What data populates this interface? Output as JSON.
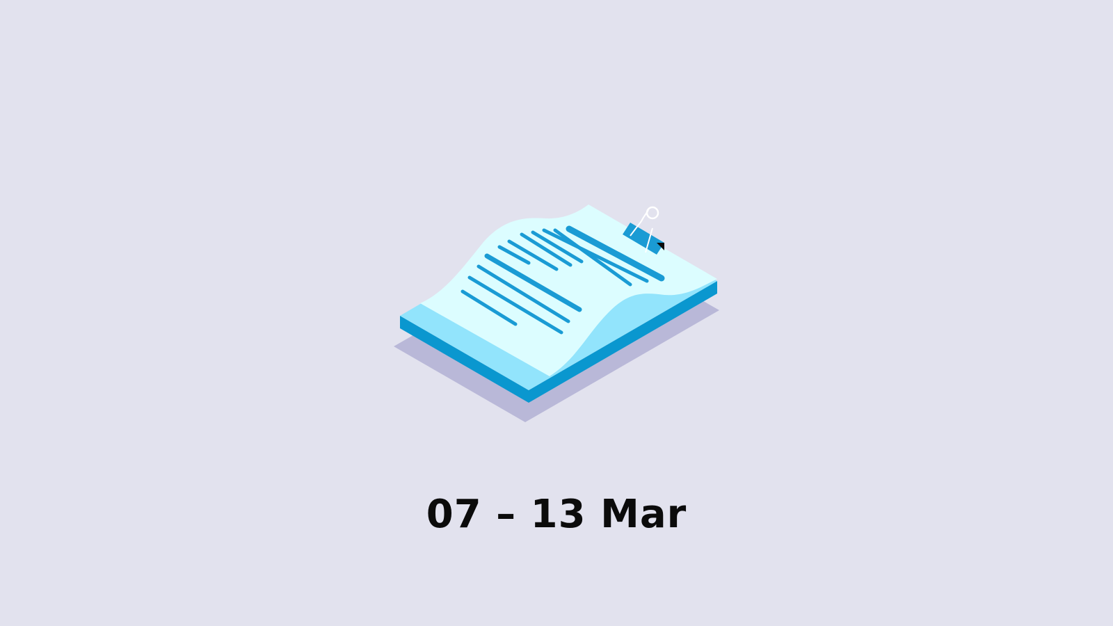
{
  "slide": {
    "date_range": "07 – 13 Mar"
  },
  "illustration": {
    "icon": "document-stack-icon",
    "clip_icon": "binder-clip-icon"
  },
  "colors": {
    "background": "#e2e2ee",
    "shadow": "#b9b8d8",
    "paper": "#dcfdff",
    "paper_fold": "#92e4fc",
    "edge": "#0a97cf",
    "line": "#1a9bd4",
    "text": "#0b0b0b"
  }
}
